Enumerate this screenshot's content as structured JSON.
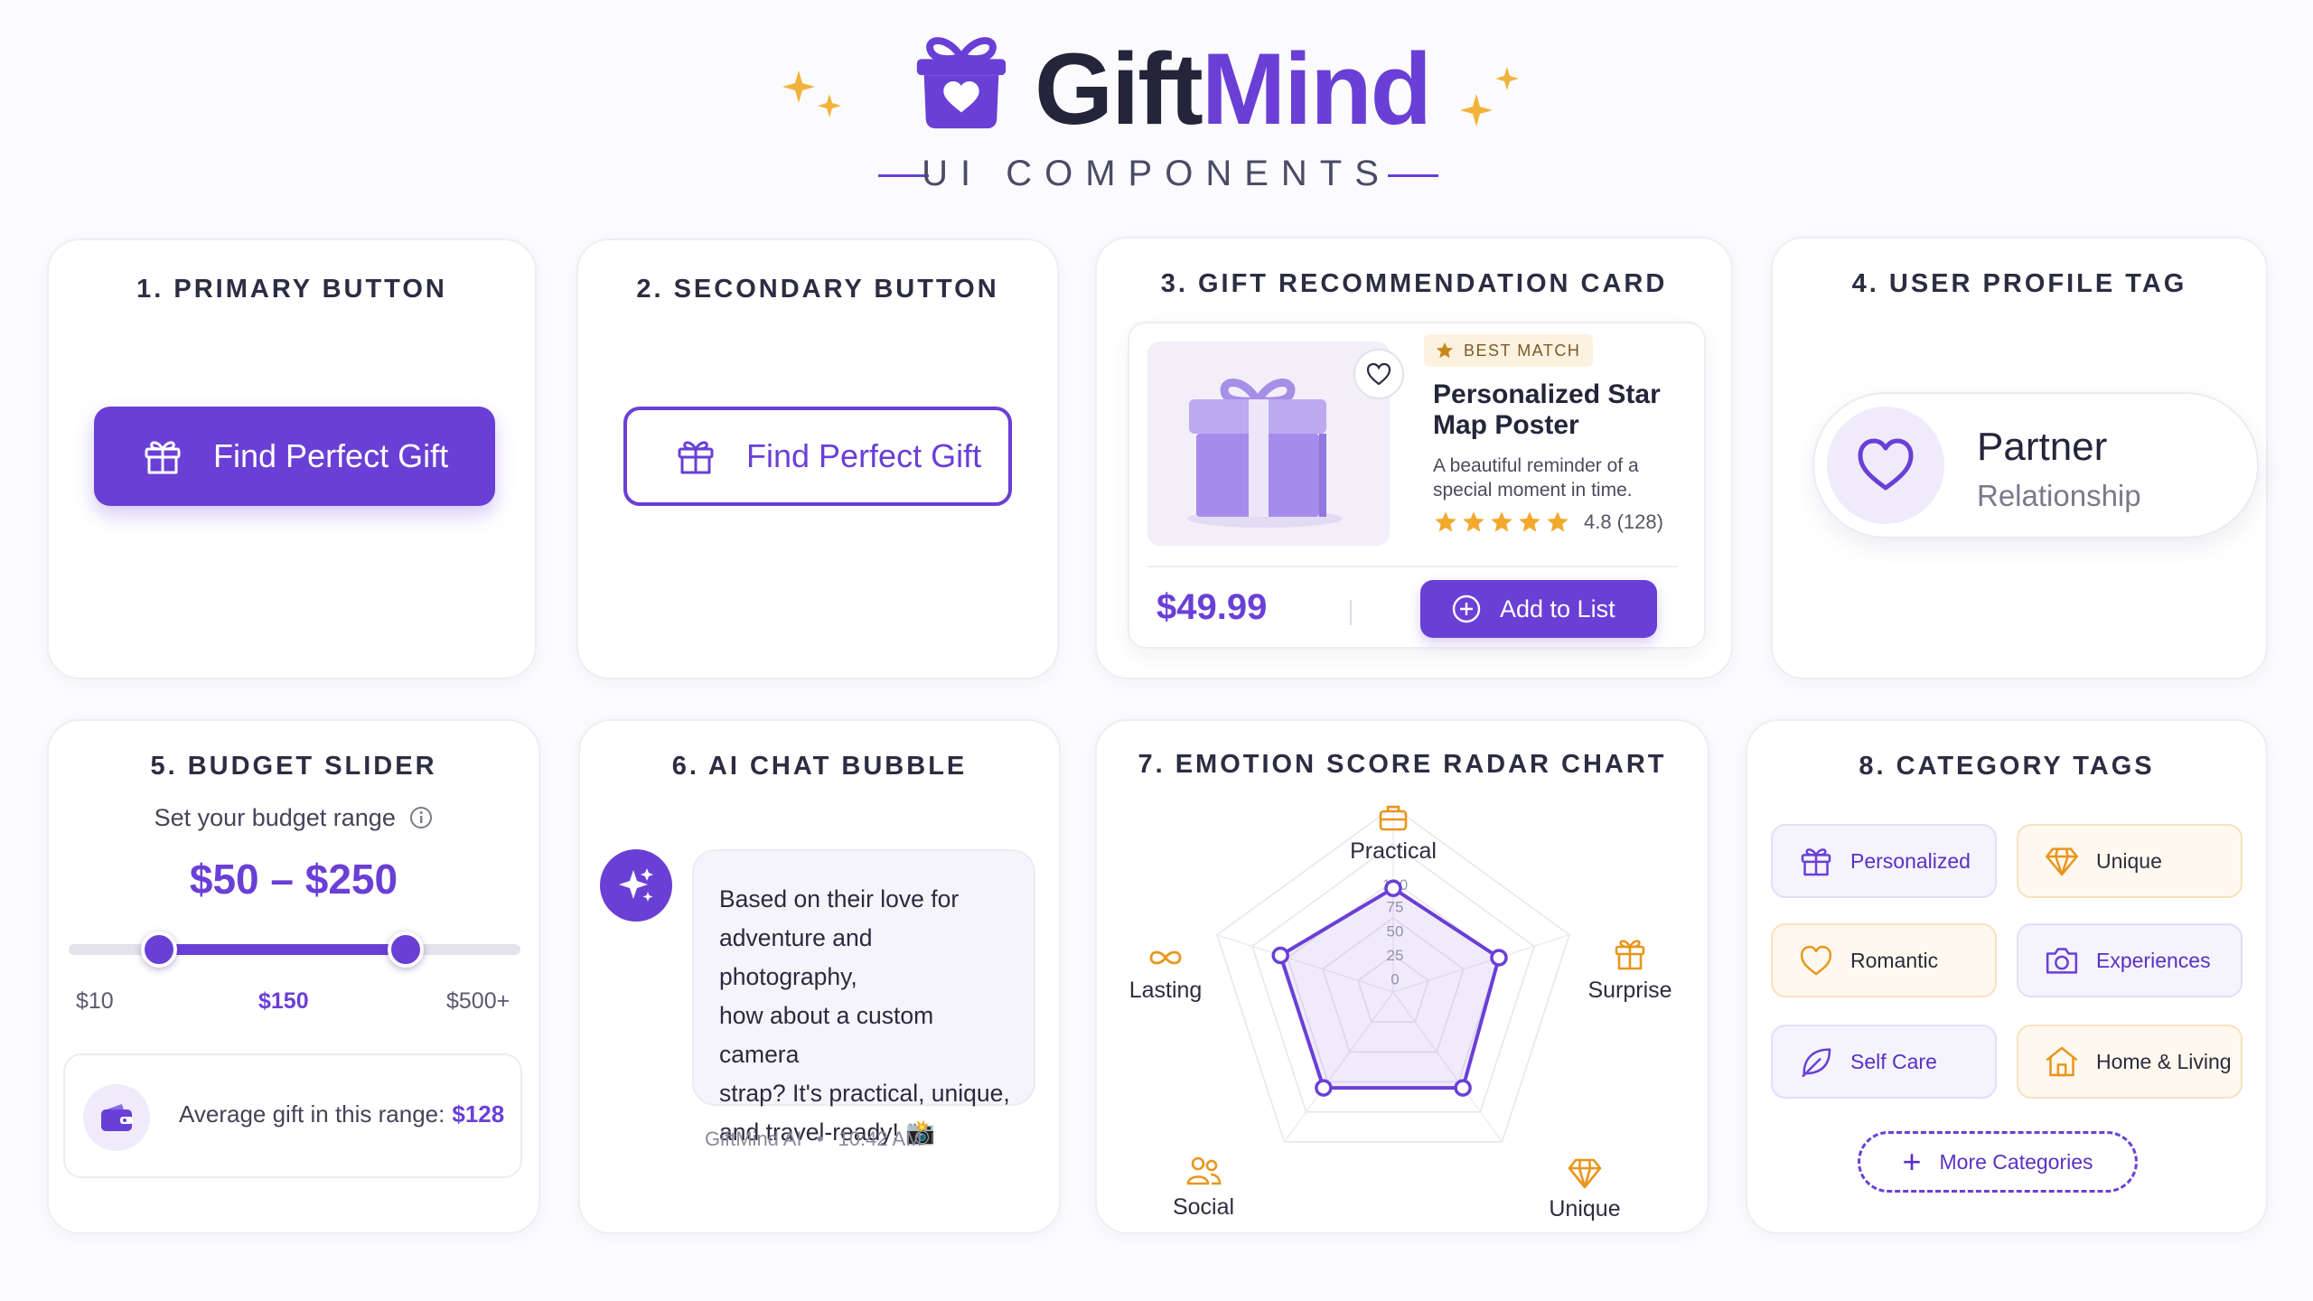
{
  "brand": {
    "name_part1": "Gift",
    "name_part2": "Mind",
    "subtitle": "UI COMPONENTS",
    "accent_color": "#6a3fd6",
    "sparkle_color": "#f2b23c"
  },
  "cards": {
    "primary_button": {
      "title": "1. PRIMARY BUTTON",
      "label": "Find Perfect Gift",
      "icon": "gift-icon"
    },
    "secondary_button": {
      "title": "2. SECONDARY BUTTON",
      "label": "Find Perfect Gift",
      "icon": "gift-icon"
    },
    "recommendation": {
      "title": "3. GIFT RECOMMENDATION CARD",
      "badge": "BEST MATCH",
      "product_name": "Personalized Star Map Poster",
      "description": "A beautiful reminder of a special moment in time.",
      "stars": 5,
      "rating": "4.8",
      "reviews": "(128)",
      "price": "$49.99",
      "add_label": "Add to List"
    },
    "profile": {
      "title": "4. USER PROFILE TAG",
      "name": "Partner",
      "relationship": "Relationship",
      "icon": "heart-icon"
    },
    "budget": {
      "title": "5. BUDGET SLIDER",
      "label": "Set your budget range",
      "range": "$50 – $250",
      "min_label": "$10",
      "mid_label": "$150",
      "max_label": "$500+",
      "low_fraction": 0.2,
      "high_fraction": 0.745,
      "avg_label": "Average gift in this range:",
      "avg_value": "$128"
    },
    "chat": {
      "title": "6. AI CHAT BUBBLE",
      "lines": [
        "Based on their love for",
        "adventure and photography,",
        "how about a custom camera",
        "strap? It's practical, unique,",
        "and travel-ready! 📸"
      ],
      "sender": "GiftMind AI",
      "separator": "•",
      "time": "10:42 AM"
    },
    "radar": {
      "title": "7. EMOTION SCORE RADAR CHART"
    },
    "categories": {
      "title": "8. CATEGORY TAGS",
      "tags": [
        {
          "label": "Personalized",
          "icon": "gift-icon",
          "style": "purple"
        },
        {
          "label": "Unique",
          "icon": "diamond-icon",
          "style": "orange"
        },
        {
          "label": "Romantic",
          "icon": "heart-icon",
          "style": "orange"
        },
        {
          "label": "Experiences",
          "icon": "camera-icon",
          "style": "purple"
        },
        {
          "label": "Self Care",
          "icon": "leaf-icon",
          "style": "purple"
        },
        {
          "label": "Home & Living",
          "icon": "home-icon",
          "style": "orange"
        }
      ],
      "more_label": "More Categories"
    }
  },
  "chart_data": {
    "type": "radar",
    "axes": [
      "Practical",
      "Surprise",
      "Unique",
      "Social",
      "Lasting"
    ],
    "axis_icons": [
      "bag-icon",
      "gift-icon",
      "diamond-icon",
      "people-icon",
      "infinity-icon"
    ],
    "ticks": [
      "0",
      "25",
      "50",
      "75",
      "100"
    ],
    "range": [
      0,
      100
    ],
    "values": [
      70,
      75,
      80,
      80,
      80
    ],
    "fill_color": "#6a3fd6"
  }
}
